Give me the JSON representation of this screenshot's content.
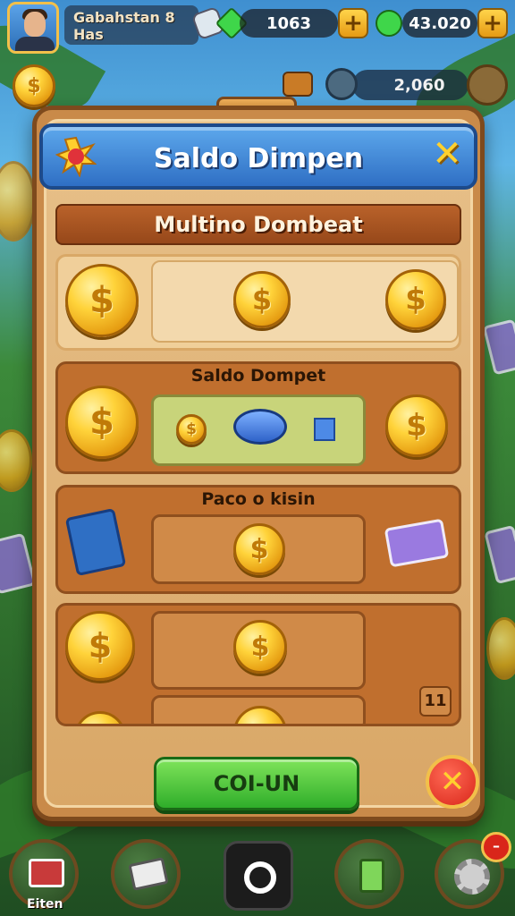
{
  "player": {
    "name_line1": "Gabahstan 8",
    "name_line2": "Has"
  },
  "resources": [
    {
      "value": "1063",
      "plus": "+"
    },
    {
      "value": "43.020",
      "plus": "+"
    }
  ],
  "subhud": {
    "value": "2,060"
  },
  "dialog": {
    "title": "Saldo Dimpen",
    "close": "✕",
    "section_title": "Multino Dombeat",
    "rows": [
      {
        "label": ""
      },
      {
        "label": "Saldo Dompet"
      },
      {
        "label": "Paco o kisin"
      },
      {
        "label": "",
        "badge": "11"
      }
    ]
  },
  "actions": {
    "confirm_label": "COI-UN",
    "cancel": "✕"
  },
  "bottom_nav": {
    "left_label": "Eiten",
    "badge": "–"
  },
  "colors": {
    "accent_blue": "#2f6fc4",
    "panel_brown": "#c98a49",
    "go_green": "#2fae2a",
    "coin_gold": "#ffd33a"
  }
}
